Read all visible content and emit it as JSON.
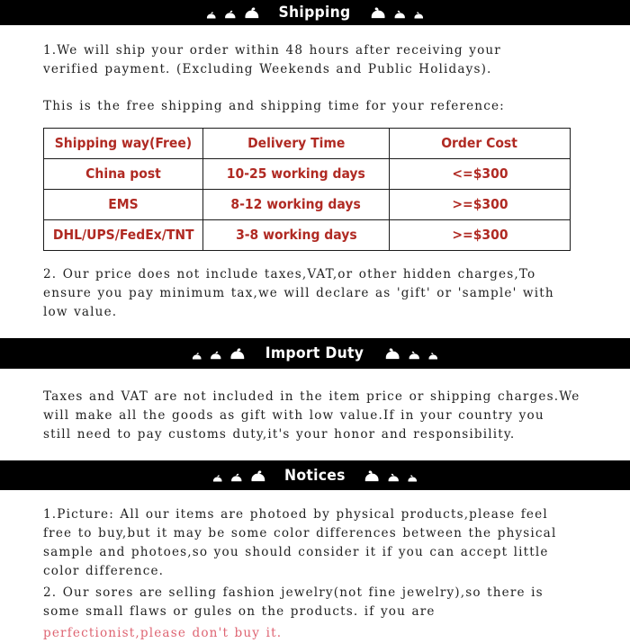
{
  "sections": [
    {
      "id": "shipping",
      "banner_title": "Shipping",
      "paragraphs": [
        "1.We will ship your order within 48 hours after receiving your\nverified payment. (Excluding Weekends and Public Holidays).",
        "This is the free shipping and shipping time for your reference:"
      ],
      "after_paragraphs": [
        "2. Our price does not include taxes,VAT,or other hidden charges,To\nensure you pay minimum tax,we will declare as 'gift' or 'sample' with\nlow value."
      ]
    },
    {
      "id": "import-duty",
      "banner_title": "Import Duty",
      "paragraphs": [
        "Taxes and VAT are not included in the item price or shipping charges.We\nwill make all the goods as gift with low value.If in your country you\nstill need to pay customs duty,it's your honor and responsibility."
      ]
    },
    {
      "id": "notices",
      "banner_title": "Notices",
      "paragraphs": [
        "1.Picture: All our items are photoed by physical products,please feel\nfree to buy,but it may be some color differences between the physical\nsample and photoes,so you should consider it if you can accept little\ncolor difference.",
        "2. Our sores are selling fashion jewelry(not fine jewelry),so there is\nsome small flaws or gules on the products. if you are"
      ],
      "red_paragraph": "perfectionist,please don't buy it."
    }
  ],
  "shipping_table": {
    "headers": [
      "Shipping way(Free)",
      "Delivery Time",
      "Order Cost"
    ],
    "rows": [
      [
        "China post",
        "10-25 working days",
        "<=$300"
      ],
      [
        "EMS",
        "8-12 working days",
        ">=$300"
      ],
      [
        "DHL/UPS/FedEx/TNT",
        "3-8 working days",
        ">=$300"
      ]
    ]
  },
  "colors": {
    "banner_bg": "#000000",
    "banner_text": "#ffffff",
    "table_text": "#b02a23",
    "table_border": "#1b1b1b",
    "body_text": "#222222",
    "warning_text": "#de6472"
  },
  "decor": {
    "icon_name": "snail-icon",
    "left_sizes": [
      11,
      13,
      17
    ],
    "right_sizes": [
      17,
      13,
      11
    ]
  }
}
